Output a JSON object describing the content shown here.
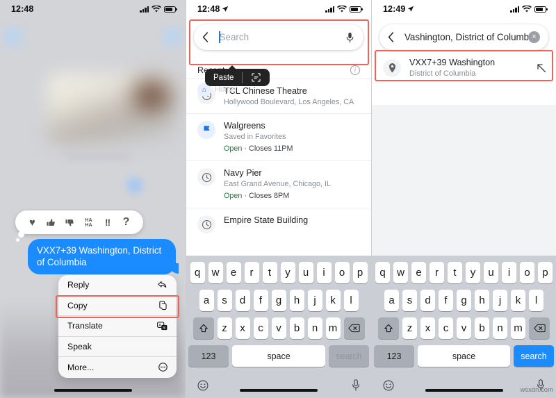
{
  "panel1": {
    "status": {
      "time": "12:48",
      "location_arrow": false
    },
    "reactions": [
      {
        "name": "heart",
        "glyph": "♥"
      },
      {
        "name": "thumbs-up",
        "glyph": "👍"
      },
      {
        "name": "thumbs-down",
        "glyph": "👎"
      },
      {
        "name": "haha",
        "glyph": "HA HA"
      },
      {
        "name": "exclamation",
        "glyph": "!!"
      },
      {
        "name": "question",
        "glyph": "?"
      }
    ],
    "message": "VXX7+39 Washington, District of Columbia",
    "menu": [
      {
        "label": "Reply",
        "icon": "reply-arrow-icon"
      },
      {
        "label": "Copy",
        "icon": "copy-pages-icon",
        "highlighted": true
      },
      {
        "label": "Translate",
        "icon": "translate-icon"
      },
      {
        "label": "Speak",
        "icon": ""
      },
      {
        "label": "More...",
        "icon": "ellipsis-circle-icon"
      }
    ]
  },
  "panel2": {
    "status": {
      "time": "12:48"
    },
    "search": {
      "placeholder": "Search",
      "value": ""
    },
    "paste_tooltip": {
      "label": "Paste",
      "scan_icon": "scan-text-icon"
    },
    "home_chip": {
      "label": "Home"
    },
    "recent": {
      "title": "Recent",
      "items": [
        {
          "name": "TCL Chinese Theatre",
          "sub": "Hollywood Boulevard, Los Angeles, CA",
          "open": "",
          "closes": "",
          "icon": "clock-icon"
        },
        {
          "name": "Walgreens",
          "sub": "Saved in Favorites",
          "open": "Open",
          "closes": "Closes 11PM",
          "icon": "favorite-flag-icon"
        },
        {
          "name": "Navy Pier",
          "sub": "East Grand Avenue, Chicago, IL",
          "open": "Open",
          "closes": "Closes 8PM",
          "icon": "clock-icon"
        },
        {
          "name": "Empire State Building",
          "sub": "",
          "open": "",
          "closes": "",
          "icon": "clock-icon"
        }
      ]
    },
    "keyboard": {
      "row1": [
        "q",
        "w",
        "e",
        "r",
        "t",
        "y",
        "u",
        "i",
        "o",
        "p"
      ],
      "row2": [
        "a",
        "s",
        "d",
        "f",
        "g",
        "h",
        "j",
        "k",
        "l"
      ],
      "row3": [
        "z",
        "x",
        "c",
        "v",
        "b",
        "n",
        "m"
      ],
      "numbers_key": "123",
      "space_key": "space",
      "action_key": "search",
      "action_enabled": false
    }
  },
  "panel3": {
    "status": {
      "time": "12:49"
    },
    "search": {
      "value": "Vashington, District of Columbia",
      "clear_icon": "clear-circle-icon"
    },
    "result": {
      "name": "VXX7+39 Washington",
      "sub": "District of Columbia",
      "pin_icon": "map-pin-icon",
      "arrow_icon": "arrow-up-left-icon"
    },
    "keyboard": {
      "row1": [
        "q",
        "w",
        "e",
        "r",
        "t",
        "y",
        "u",
        "i",
        "o",
        "p"
      ],
      "row2": [
        "a",
        "s",
        "d",
        "f",
        "g",
        "h",
        "j",
        "k",
        "l"
      ],
      "row3": [
        "z",
        "x",
        "c",
        "v",
        "b",
        "n",
        "m"
      ],
      "numbers_key": "123",
      "space_key": "space",
      "action_key": "search",
      "action_enabled": true
    },
    "watermark": "wsxdn.com"
  },
  "colors": {
    "highlight_red": "#f16357",
    "bubble_blue": "#1a8cff",
    "open_green": "#188038",
    "accent_blue": "#1a73e8"
  }
}
